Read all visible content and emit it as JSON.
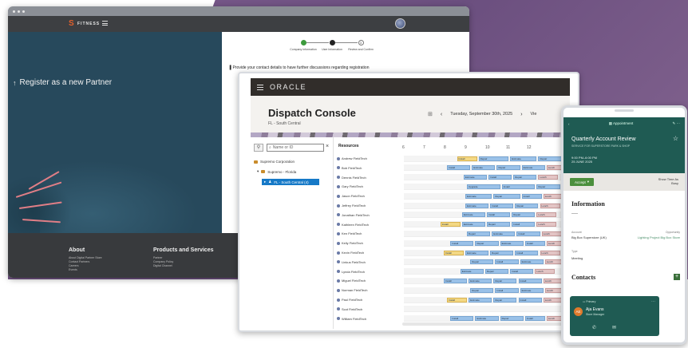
{
  "partner_portal": {
    "brand": "FITNESS",
    "hero_title": "Register as a new Partner",
    "steps": [
      {
        "label": "Company Information",
        "state": "done"
      },
      {
        "label": "User Information",
        "state": "current"
      },
      {
        "label": "Review and Confirm",
        "state": "todo",
        "number": "3"
      }
    ],
    "instructions": "Provide your contact details to have further discussions regarding registration",
    "footer": {
      "about": {
        "heading": "About",
        "links": [
          "About Digital Partner Store",
          "Contact Partners",
          "Careers",
          "Events"
        ]
      },
      "products": {
        "heading": "Products and Services",
        "links": [
          "Partner",
          "Company Policy",
          "Digital Channel"
        ]
      }
    }
  },
  "dispatch": {
    "brand": "ORACLE",
    "title": "Dispatch Console",
    "subtitle": "FL - South Central",
    "date": "Tuesday, September 30th, 2025",
    "view_label": "Vie",
    "search_placeholder": "Name or ID",
    "tree": [
      "Supremo Corporation",
      "Supremo - Florida",
      "FL - South Central (4)"
    ],
    "resources_header": "Resources",
    "hours": [
      "6",
      "7",
      "8",
      "9",
      "10",
      "11",
      "12"
    ],
    "resources": [
      {
        "name": "Andrew FieldTech",
        "tasks": [
          {
            "s": 0.32,
            "w": 0.12,
            "label": "Install",
            "t": "alt"
          },
          {
            "s": 0.45,
            "w": 0.18,
            "label": "Repair"
          },
          {
            "s": 0.64,
            "w": 0.16,
            "label": "Estimate"
          },
          {
            "s": 0.81,
            "w": 0.14,
            "label": "Repair"
          }
        ]
      },
      {
        "name": "Bob FieldTech",
        "tasks": [
          {
            "s": 0.26,
            "w": 0.14,
            "label": "Install"
          },
          {
            "s": 0.41,
            "w": 0.14,
            "label": "Estimate"
          },
          {
            "s": 0.56,
            "w": 0.14,
            "label": "Repair"
          },
          {
            "s": 0.71,
            "w": 0.14,
            "label": "Estimate"
          },
          {
            "s": 0.86,
            "w": 0.12,
            "label": "Lunch",
            "t": "red"
          }
        ]
      },
      {
        "name": "Dennis FieldTech",
        "tasks": [
          {
            "s": 0.36,
            "w": 0.14,
            "label": "Estimate"
          },
          {
            "s": 0.51,
            "w": 0.14,
            "label": "Install"
          },
          {
            "s": 0.66,
            "w": 0.14,
            "label": "Repair"
          },
          {
            "s": 0.81,
            "w": 0.12,
            "label": "Lunch",
            "t": "red"
          }
        ]
      },
      {
        "name": "Gary FieldTech",
        "tasks": [
          {
            "s": 0.38,
            "w": 0.2,
            "label": "Upgrade"
          },
          {
            "s": 0.59,
            "w": 0.2,
            "label": "Install"
          },
          {
            "s": 0.8,
            "w": 0.14,
            "label": "Repair"
          }
        ]
      },
      {
        "name": "Jason FieldTech",
        "tasks": [
          {
            "s": 0.37,
            "w": 0.16,
            "label": "Estimate"
          },
          {
            "s": 0.54,
            "w": 0.16,
            "label": "Repair"
          },
          {
            "s": 0.71,
            "w": 0.12,
            "label": "Install"
          },
          {
            "s": 0.84,
            "w": 0.12,
            "label": "Lunch",
            "t": "red"
          }
        ]
      },
      {
        "name": "Jeffrey FieldTech",
        "tasks": [
          {
            "s": 0.37,
            "w": 0.14,
            "label": "Estimate"
          },
          {
            "s": 0.52,
            "w": 0.14,
            "label": "Install"
          },
          {
            "s": 0.67,
            "w": 0.14,
            "label": "Repair"
          },
          {
            "s": 0.82,
            "w": 0.12,
            "label": "Lunch",
            "t": "red"
          }
        ]
      },
      {
        "name": "Jonathan FieldTech",
        "tasks": [
          {
            "s": 0.35,
            "w": 0.14,
            "label": "Estimate"
          },
          {
            "s": 0.5,
            "w": 0.14,
            "label": "Install"
          },
          {
            "s": 0.65,
            "w": 0.14,
            "label": "Repair"
          },
          {
            "s": 0.8,
            "w": 0.12,
            "label": "Lunch",
            "t": "red"
          }
        ]
      },
      {
        "name": "Kathleen FieldTech",
        "tasks": [
          {
            "s": 0.22,
            "w": 0.12,
            "label": "Install",
            "t": "alt"
          },
          {
            "s": 0.35,
            "w": 0.14,
            "label": "Estimate"
          },
          {
            "s": 0.5,
            "w": 0.14,
            "label": "Repair"
          },
          {
            "s": 0.65,
            "w": 0.14,
            "label": "Install"
          },
          {
            "s": 0.8,
            "w": 0.12,
            "label": "Lunch",
            "t": "red"
          }
        ]
      },
      {
        "name": "Ken FieldTech",
        "tasks": [
          {
            "s": 0.38,
            "w": 0.14,
            "label": "Repair"
          },
          {
            "s": 0.53,
            "w": 0.14,
            "label": "Estimate"
          },
          {
            "s": 0.68,
            "w": 0.14,
            "label": "Install"
          },
          {
            "s": 0.83,
            "w": 0.12,
            "label": "Lunch",
            "t": "red"
          }
        ]
      },
      {
        "name": "Kelly FieldTech",
        "tasks": [
          {
            "s": 0.28,
            "w": 0.14,
            "label": "Install"
          },
          {
            "s": 0.43,
            "w": 0.14,
            "label": "Repair"
          },
          {
            "s": 0.58,
            "w": 0.14,
            "label": "Estimate"
          },
          {
            "s": 0.73,
            "w": 0.12,
            "label": "Install"
          },
          {
            "s": 0.86,
            "w": 0.12,
            "label": "Lunch",
            "t": "red"
          }
        ]
      },
      {
        "name": "Kevin FieldTech",
        "tasks": [
          {
            "s": 0.24,
            "w": 0.12,
            "label": "Install",
            "t": "alt"
          },
          {
            "s": 0.37,
            "w": 0.14,
            "label": "Estimate"
          },
          {
            "s": 0.52,
            "w": 0.14,
            "label": "Repair"
          },
          {
            "s": 0.67,
            "w": 0.14,
            "label": "Install"
          },
          {
            "s": 0.82,
            "w": 0.12,
            "label": "Lunch",
            "t": "red"
          }
        ]
      },
      {
        "name": "Linkus FieldTech",
        "tasks": [
          {
            "s": 0.4,
            "w": 0.14,
            "label": "Repair"
          },
          {
            "s": 0.55,
            "w": 0.14,
            "label": "Install"
          },
          {
            "s": 0.7,
            "w": 0.14,
            "label": "Estimate"
          },
          {
            "s": 0.85,
            "w": 0.12,
            "label": "Lunch",
            "t": "red"
          }
        ]
      },
      {
        "name": "Lynda FieldTech",
        "tasks": [
          {
            "s": 0.34,
            "w": 0.14,
            "label": "Estimate"
          },
          {
            "s": 0.49,
            "w": 0.14,
            "label": "Repair"
          },
          {
            "s": 0.64,
            "w": 0.14,
            "label": "Install"
          },
          {
            "s": 0.79,
            "w": 0.12,
            "label": "Lunch",
            "t": "red"
          }
        ]
      },
      {
        "name": "Miguel FieldTech",
        "tasks": [
          {
            "s": 0.24,
            "w": 0.14,
            "label": "Install"
          },
          {
            "s": 0.39,
            "w": 0.14,
            "label": "Estimate"
          },
          {
            "s": 0.54,
            "w": 0.14,
            "label": "Repair"
          },
          {
            "s": 0.69,
            "w": 0.14,
            "label": "Install"
          },
          {
            "s": 0.84,
            "w": 0.12,
            "label": "Lunch",
            "t": "red"
          }
        ]
      },
      {
        "name": "Norman FieldTech",
        "tasks": [
          {
            "s": 0.4,
            "w": 0.14,
            "label": "Repair"
          },
          {
            "s": 0.55,
            "w": 0.14,
            "label": "Install"
          },
          {
            "s": 0.7,
            "w": 0.14,
            "label": "Estimate"
          },
          {
            "s": 0.85,
            "w": 0.12,
            "label": "Lunch",
            "t": "red"
          }
        ]
      },
      {
        "name": "Paul FieldTech",
        "tasks": [
          {
            "s": 0.26,
            "w": 0.12,
            "label": "Install",
            "t": "alt"
          },
          {
            "s": 0.39,
            "w": 0.14,
            "label": "Estimate"
          },
          {
            "s": 0.54,
            "w": 0.14,
            "label": "Repair"
          },
          {
            "s": 0.69,
            "w": 0.14,
            "label": "Install"
          },
          {
            "s": 0.84,
            "w": 0.12,
            "label": "Lunch",
            "t": "red"
          }
        ]
      },
      {
        "name": "Scot FieldTech",
        "tasks": []
      },
      {
        "name": "William FieldTech",
        "tasks": [
          {
            "s": 0.28,
            "w": 0.14,
            "label": "Install"
          },
          {
            "s": 0.43,
            "w": 0.14,
            "label": "Estimate"
          },
          {
            "s": 0.58,
            "w": 0.14,
            "label": "Repair"
          },
          {
            "s": 0.73,
            "w": 0.12,
            "label": "Install"
          },
          {
            "s": 0.86,
            "w": 0.12,
            "label": "Lunch",
            "t": "red"
          }
        ]
      }
    ]
  },
  "mobile": {
    "header_title": "Appointment",
    "appt_title": "Quarterly Account Review",
    "appt_sub": "SERVICE FOR SUPERSTORE PARK & SHOP",
    "time": "9:00 PM–6:00 PM",
    "date": "25 JUNE 2025",
    "accept_label": "Accept",
    "more_label": "Show Time As",
    "more_value": "Busy",
    "info_heading": "Information",
    "account_label": "Account",
    "account_value": "Big Box Superstore (UK)",
    "opportunity_label": "Opportunity",
    "opportunity_value": "Lighting Project Big Box Store",
    "type_label": "Type",
    "type_value": "Meeting",
    "contacts_heading": "Contacts",
    "contact": {
      "badge": "Primary",
      "initials": "AE",
      "name": "Aja Evans",
      "role": "Store Manager"
    }
  }
}
